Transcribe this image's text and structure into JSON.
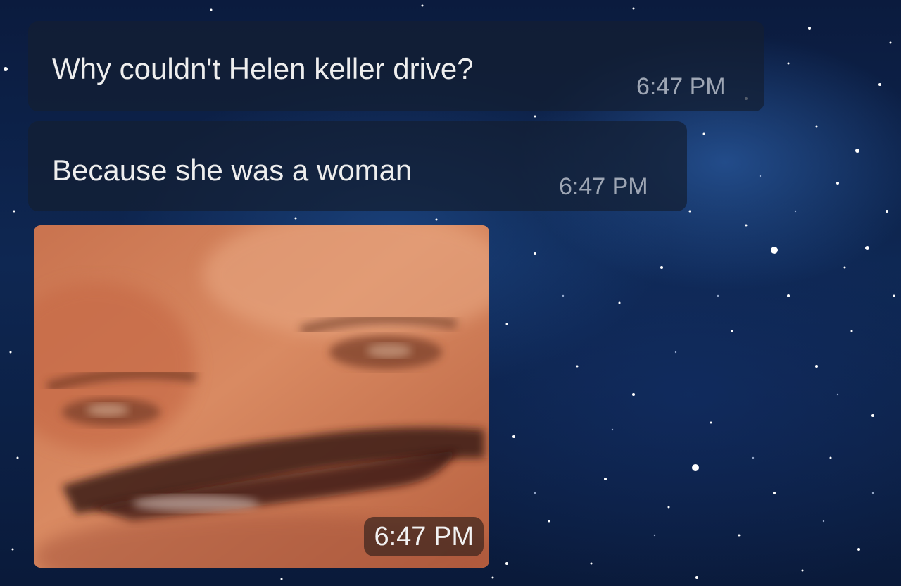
{
  "messages": [
    {
      "text": "Why couldn't Helen keller drive?",
      "time": "6:47 PM"
    },
    {
      "text": "Because she was a woman",
      "time": "6:47 PM"
    }
  ],
  "photo_message": {
    "time": "6:47 PM",
    "subject": "blurred close-up of a laughing man with a mustache"
  },
  "colors": {
    "bubble": "#141e32",
    "text": "#eeeeee",
    "time": "#9ea6b4",
    "background": "#0e2752"
  }
}
